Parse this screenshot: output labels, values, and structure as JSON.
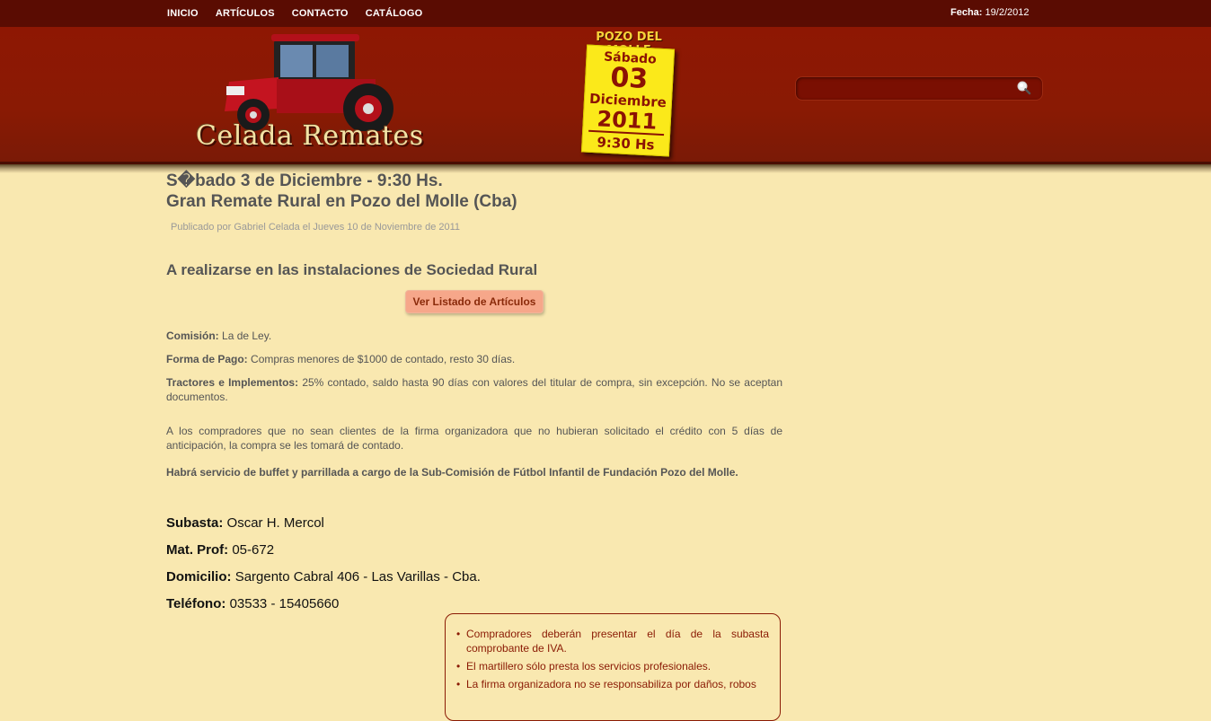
{
  "nav": {
    "items": [
      {
        "label": "INICIO"
      },
      {
        "label": "ARTÍCULOS"
      },
      {
        "label": "CONTACTO"
      },
      {
        "label": "CATÁLOGO"
      }
    ],
    "date_label": "Fecha:",
    "date_value": "19/2/2012"
  },
  "header": {
    "logo_text": "Celada Remates",
    "banner": {
      "location": "POZO DEL MOLLE",
      "day_name": "Sábado",
      "day_number": "03",
      "month": "Diciembre",
      "year": "2011",
      "time": "9:30 Hs"
    },
    "search": {
      "value": "",
      "icon": "search-icon"
    }
  },
  "article": {
    "title_line1": "S�bado 3 de Diciembre - 9:30 Hs.",
    "title_line2": "Gran Remate Rural en Pozo del Molle (Cba)",
    "meta": "Publicado por Gabriel Celada el Jueves 10 de Noviembre de 2011",
    "subtitle": "A realizarse en las instalaciones de Sociedad Rural",
    "button_label": "Ver Listado de Artículos",
    "comision_label": "Comisión:",
    "comision_value": "La de Ley.",
    "pago_label": "Forma de Pago:",
    "pago_value": "Compras menores de $1000 de contado, resto 30 días.",
    "tractores_label": "Tractores e Implementos:",
    "tractores_value": "25% contado, saldo hasta 90 días con valores del titular de compra, sin excepción. No se aceptan documentos.",
    "compradores_text": "A los compradores que no sean clientes de la firma organizadora que no hubieran solicitado el crédito con 5 días de anticipación, la compra se les tomará de contado.",
    "buffet_text": "Habrá servicio de buffet y parrillada a cargo de la Sub-Comisión de Fútbol Infantil de Fundación Pozo del Molle."
  },
  "contact": {
    "subasta_label": "Subasta:",
    "subasta_value": "Oscar H. Mercol",
    "mat_label": "Mat. Prof:",
    "mat_value": "05-672",
    "domicilio_label": "Domicilio:",
    "domicilio_value": "Sargento Cabral 406 - Las Varillas - Cba.",
    "telefono_label": "Teléfono:",
    "telefono_value": "03533 - 15405660"
  },
  "notice": {
    "items": [
      "Compradores deberán presentar el día de la subasta comprobante de IVA.",
      "El martillero sólo presta los servicios profesionales.",
      "La firma organizadora no se responsabiliza por daños, robos"
    ]
  }
}
